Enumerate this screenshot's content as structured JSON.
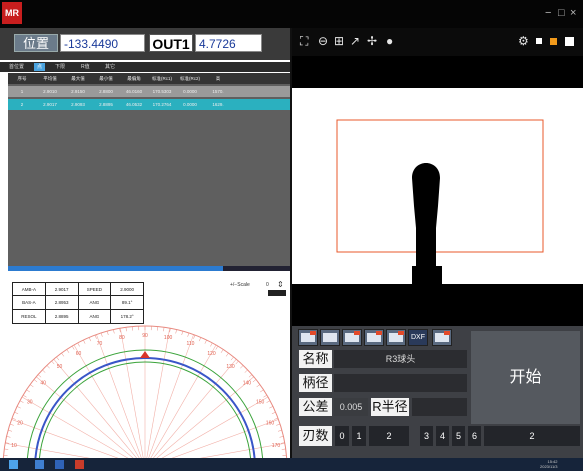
{
  "app": {
    "logo_text": "MR",
    "window_controls": [
      "−",
      "□",
      "×"
    ]
  },
  "readout": {
    "position_label": "位置",
    "position_value": "-133.4490",
    "out_label": "OUT1",
    "out_value": "4.7726"
  },
  "tabs": [
    "首位置",
    "点",
    "下限",
    "R值",
    "其它"
  ],
  "table": {
    "headers": [
      "序号",
      "平均值",
      "最大值",
      "最小值",
      "最偏角",
      "标准(Rc1)",
      "标准(Rc2)",
      "高"
    ],
    "rows": [
      [
        "1",
        "2.9010",
        "2.9150",
        "2.8800",
        "46.0160",
        "170.5303",
        "0.0000",
        "1570."
      ],
      [
        "2",
        "2.9017",
        "2.9093",
        "2.8895",
        "46.0532",
        "170.2764",
        "0.0000",
        "1629."
      ]
    ]
  },
  "stats": [
    [
      "AMB-A",
      "2.9017",
      "SPEED",
      "2.9000"
    ],
    [
      "BAS-A",
      "2.8953",
      "ANG",
      "89.1°"
    ],
    [
      "RESOL",
      "2.8895",
      "ANG",
      "178.2°"
    ]
  ],
  "zoom": {
    "label": "+/−Scale",
    "value": "0"
  },
  "polar": {
    "tick_labels": [
      "0",
      "10",
      "20",
      "30",
      "40",
      "50",
      "60",
      "70",
      "80",
      "90",
      "100",
      "110",
      "120",
      "130",
      "140",
      "150",
      "160",
      "170",
      "180"
    ],
    "inner_ring_color": "#3a56c8",
    "outer_ring_color": "#3aa33a",
    "marker_color": "#d9352b"
  },
  "camera": {
    "roi_color": "#e8592b"
  },
  "form": {
    "name_label": "名称",
    "name_value": "R3球头",
    "shank_label": "柄径",
    "shank_value": "",
    "tol_label": "公差",
    "tol_value": "0.005",
    "radius_label": "R半径",
    "radius_value": "",
    "start_label": "开始",
    "blades_label": "刃数",
    "blade_options": [
      "0",
      "1",
      "2",
      "3",
      "4",
      "5",
      "6"
    ],
    "blade_selected": "2",
    "dxf_label": "DXF"
  },
  "taskbar": {
    "time": "15:42",
    "date": "2023/11/3"
  }
}
